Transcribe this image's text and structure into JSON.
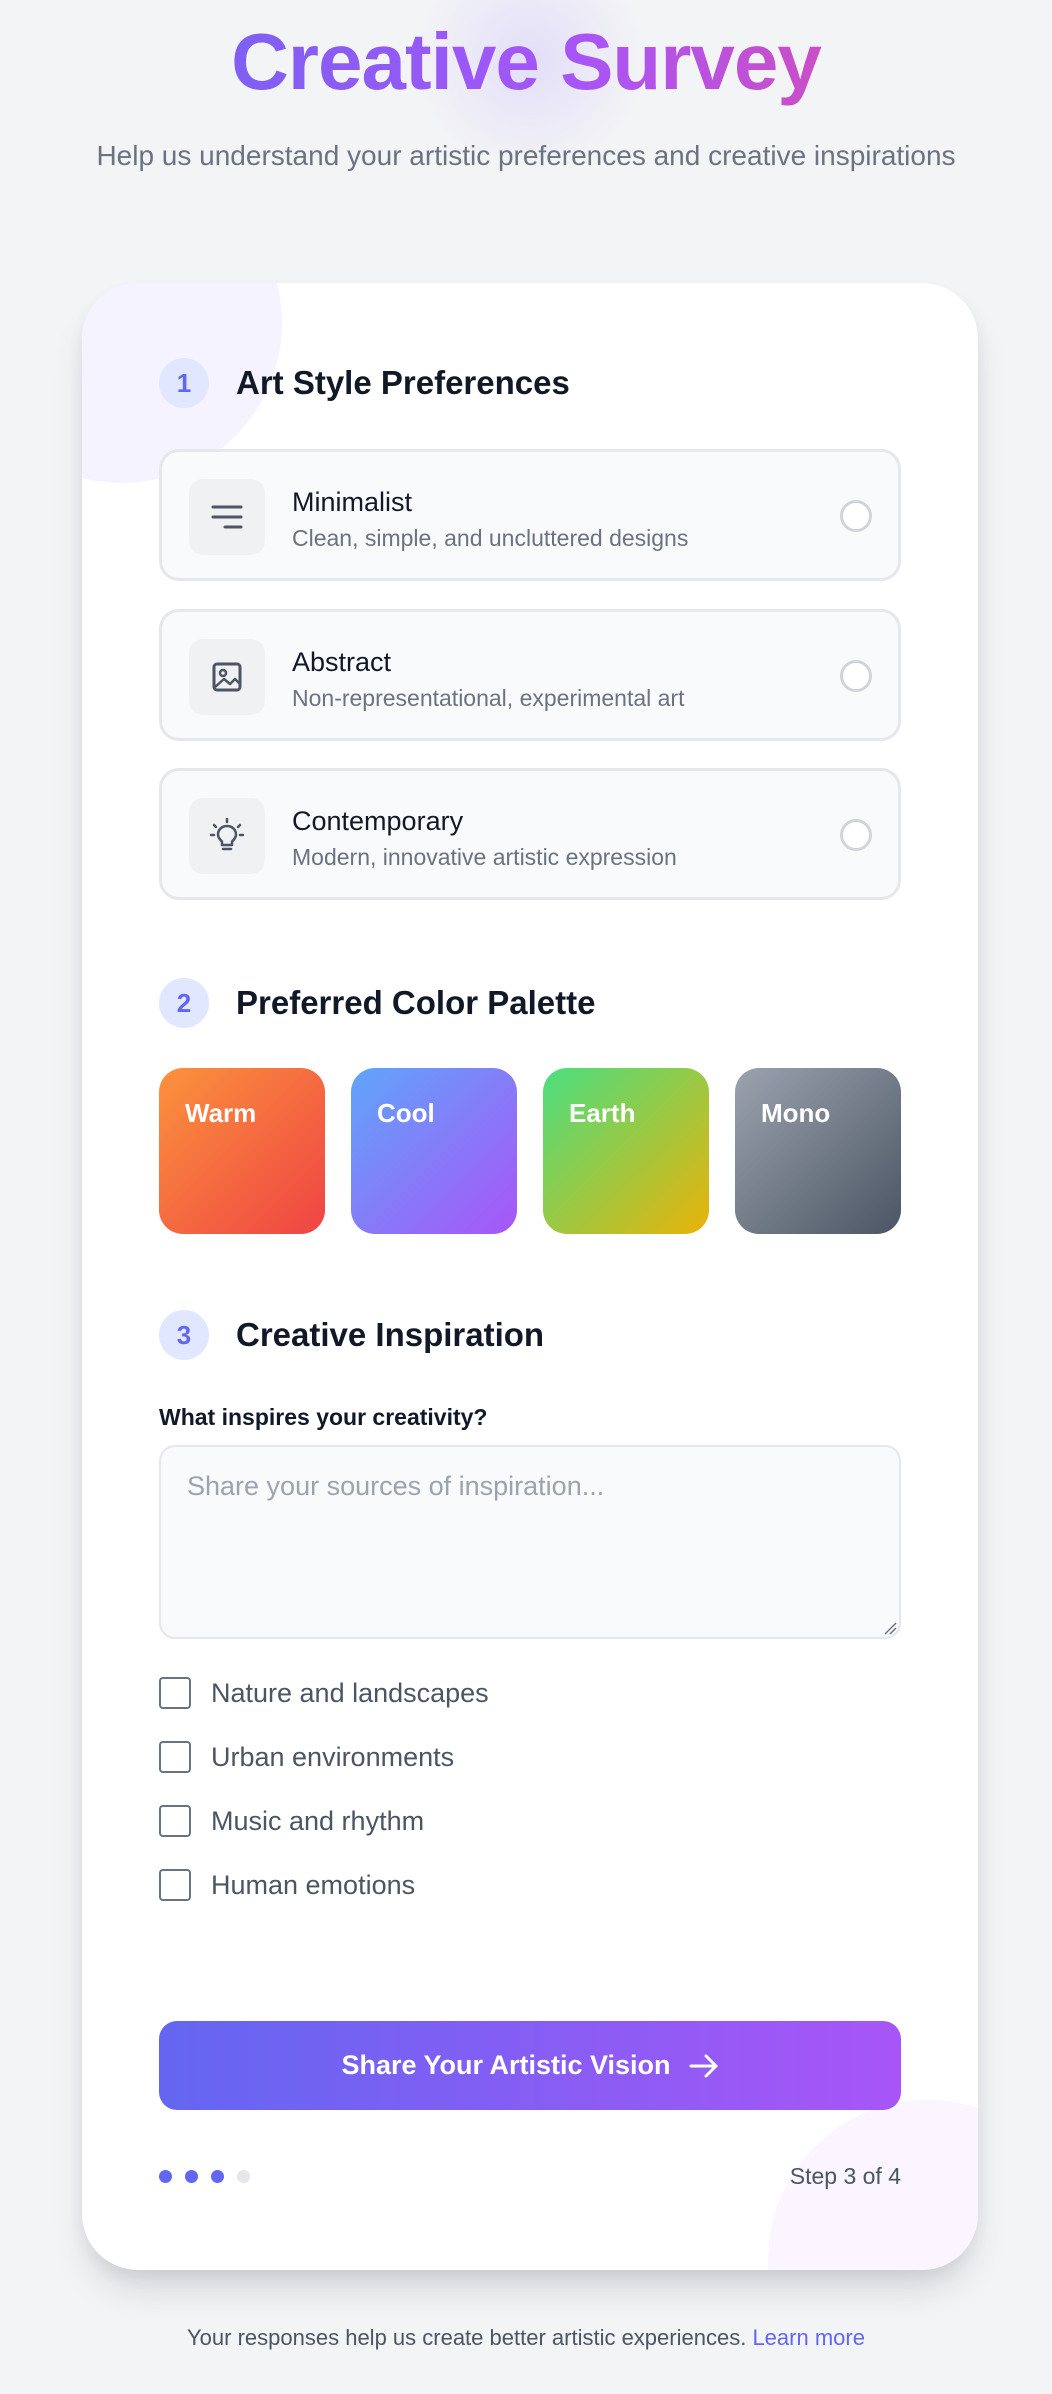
{
  "header": {
    "title": "Creative Survey",
    "subtitle": "Help us understand your artistic preferences and creative inspirations"
  },
  "sections": [
    {
      "number": "1",
      "title": "Art Style Preferences"
    },
    {
      "number": "2",
      "title": "Preferred Color Palette"
    },
    {
      "number": "3",
      "title": "Creative Inspiration"
    }
  ],
  "styles": [
    {
      "label": "Minimalist",
      "description": "Clean, simple, and uncluttered designs",
      "icon": "lines-icon",
      "selected": false
    },
    {
      "label": "Abstract",
      "description": "Non-representational, experimental art",
      "icon": "image-icon",
      "selected": false
    },
    {
      "label": "Contemporary",
      "description": "Modern, innovative artistic expression",
      "icon": "lightbulb-icon",
      "selected": false
    }
  ],
  "palettes": [
    {
      "label": "Warm",
      "colors": [
        "#fb923c",
        "#ef4444"
      ]
    },
    {
      "label": "Cool",
      "colors": [
        "#60a5fa",
        "#a855f7"
      ]
    },
    {
      "label": "Earth",
      "colors": [
        "#4ade80",
        "#eab308"
      ]
    },
    {
      "label": "Mono",
      "colors": [
        "#9ca3af",
        "#4b5563"
      ]
    }
  ],
  "inspiration": {
    "question": "What inspires your creativity?",
    "placeholder": "Share your sources of inspiration...",
    "options": [
      {
        "label": "Nature and landscapes",
        "checked": false
      },
      {
        "label": "Urban environments",
        "checked": false
      },
      {
        "label": "Music and rhythm",
        "checked": false
      },
      {
        "label": "Human emotions",
        "checked": false
      }
    ]
  },
  "cta": {
    "label": "Share Your Artistic Vision",
    "icon": "arrow-right-icon"
  },
  "progress": {
    "current": 3,
    "total": 4,
    "text": "Step 3 of 4"
  },
  "footer": {
    "text": "Your responses help us create better artistic experiences.",
    "link": "Learn more"
  },
  "colors": {
    "accent": "#6366f1",
    "accent_end": "#a855f7",
    "title_end": "#ec4899",
    "dot_inactive": "#e5e7eb"
  }
}
